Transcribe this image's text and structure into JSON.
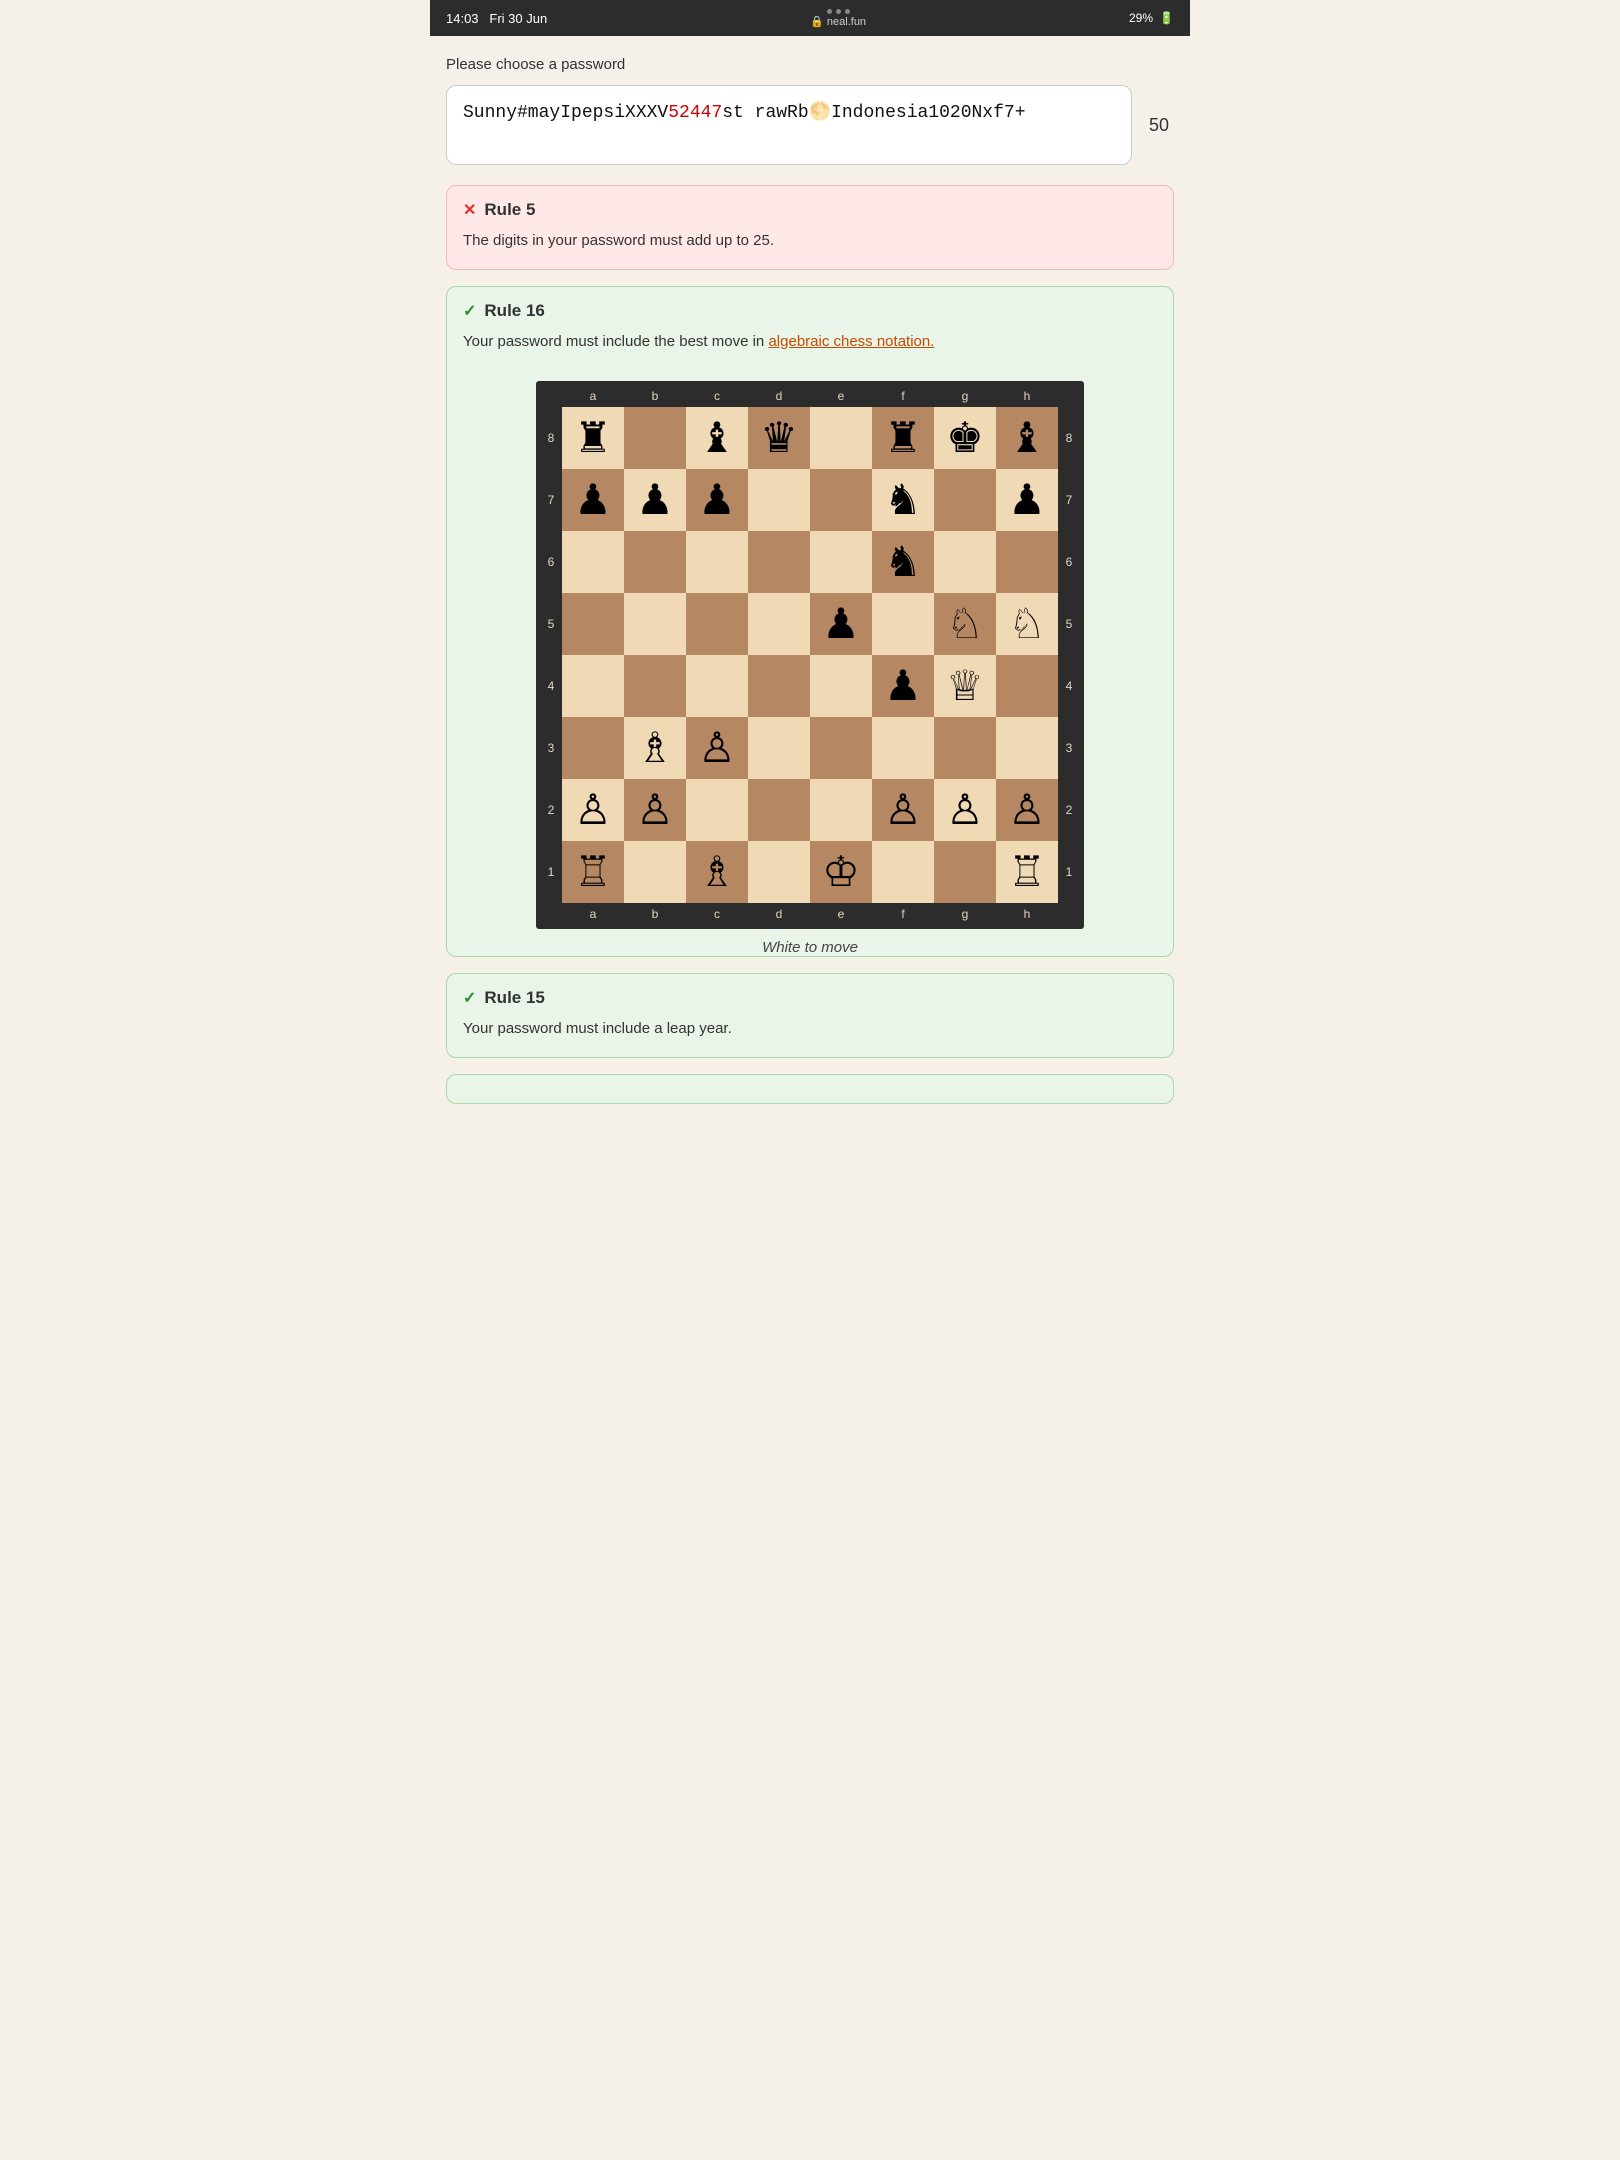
{
  "statusBar": {
    "time": "14:03",
    "date": "Fri 30 Jun",
    "dots": [
      "dot",
      "dot",
      "dot"
    ],
    "lock_icon": "🔒",
    "url": "neal.fun",
    "battery": "29%",
    "battery_icon": "🔋"
  },
  "header": {
    "choose_password_label": "Please choose a password"
  },
  "passwordInput": {
    "value": "Sunny#mayIpepsiXXXV52447strawRb🌕Indonesia1020Nxf7+",
    "charCount": "50"
  },
  "rules": [
    {
      "id": "rule5",
      "status": "fail",
      "label": "Rule 5",
      "body": "The digits in your password must add up to 25."
    },
    {
      "id": "rule16",
      "status": "pass",
      "label": "Rule 16",
      "bodyPrefix": "Your password must include the best move in ",
      "linkText": "algebraic chess notation.",
      "caption": "White to move"
    },
    {
      "id": "rule15",
      "status": "pass",
      "label": "Rule 15",
      "body": "Your password must include a leap year."
    }
  ],
  "chessBoard": {
    "files": [
      "a",
      "b",
      "c",
      "d",
      "e",
      "f",
      "g",
      "h"
    ],
    "ranks": [
      "8",
      "7",
      "6",
      "5",
      "4",
      "3",
      "2",
      "1"
    ],
    "pieces": {
      "a8": "♜",
      "c8": "♝",
      "d8": "♛",
      "f8": "♜",
      "g8": "♚",
      "h8": "♝",
      "a7": "♟",
      "b7": "♟",
      "c7": "♟",
      "f7": "♞",
      "h7": "♟",
      "f6": "♞",
      "e5": "♟",
      "g5": "♘",
      "h5": "♘",
      "f4": "♟",
      "g4": "♕",
      "b3": "♗",
      "c3": "♙",
      "a2": "♙",
      "b2": "♙",
      "f2": "♙",
      "g2": "♙",
      "h2": "♙",
      "a1": "♖",
      "c1": "♗",
      "e1": "♔",
      "h1": "♖"
    }
  },
  "icons": {
    "fail": "✕",
    "pass": "✓"
  }
}
